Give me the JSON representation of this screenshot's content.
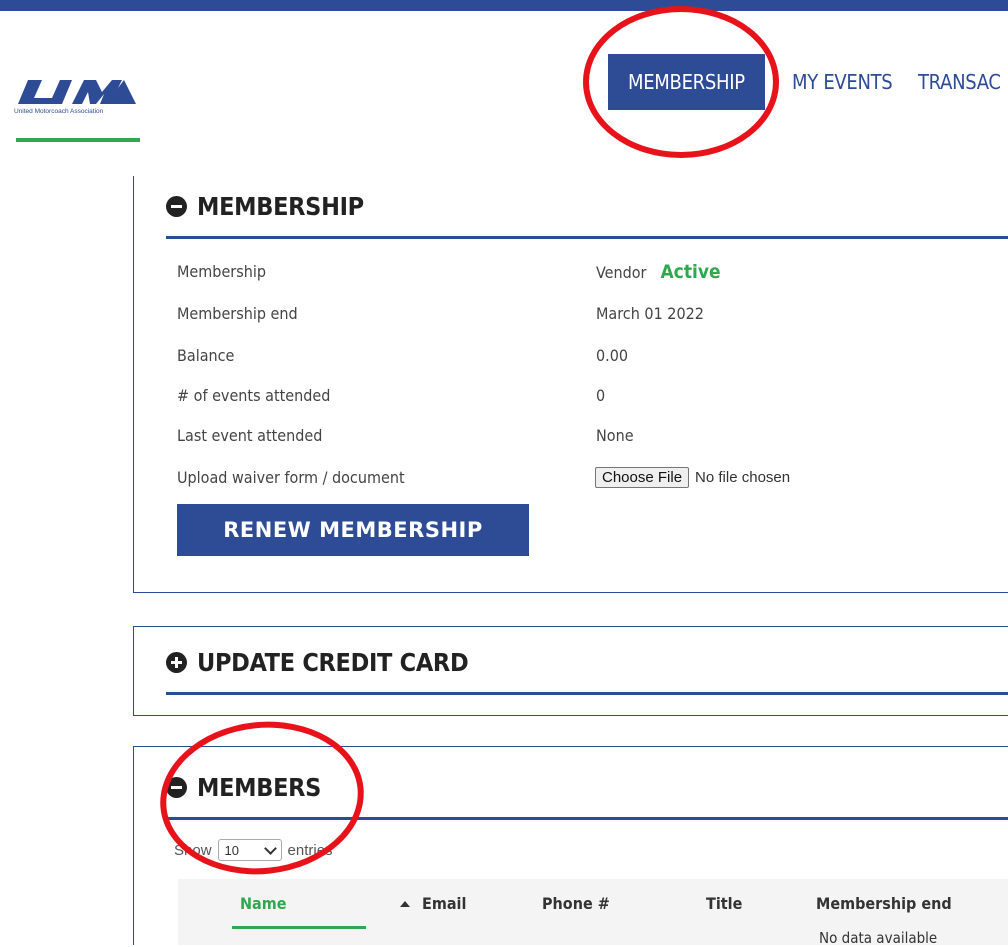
{
  "logo": {
    "caption": "United Motorcoach Association"
  },
  "nav": {
    "items": [
      {
        "label": "MEMBERSHIP",
        "active": true
      },
      {
        "label": "MY EVENTS"
      },
      {
        "label": "TRANSAC"
      }
    ]
  },
  "membership": {
    "title": "MEMBERSHIP",
    "rows": [
      {
        "label": "Membership",
        "value": "Vendor",
        "status": "Active"
      },
      {
        "label": "Membership end",
        "value": "March 01 2022"
      },
      {
        "label": "Balance",
        "value": "0.00"
      },
      {
        "label": "# of events attended",
        "value": "0"
      },
      {
        "label": "Last event attended",
        "value": "None"
      }
    ],
    "upload": {
      "label": "Upload waiver form / document",
      "button": "Choose File",
      "status": "No file chosen"
    },
    "renew_label": "RENEW MEMBERSHIP"
  },
  "update_card": {
    "title": "UPDATE CREDIT CARD"
  },
  "members": {
    "title": "MEMBERS",
    "show_label": "Show",
    "entries_value": "10",
    "entries_label": "entries",
    "columns": [
      "Name",
      "Email",
      "Phone #",
      "Title",
      "Membership end"
    ],
    "empty_text": "No data available"
  },
  "colors": {
    "brand": "#2e4c95",
    "active": "#2fa84f",
    "annotation": "#e8121b"
  }
}
